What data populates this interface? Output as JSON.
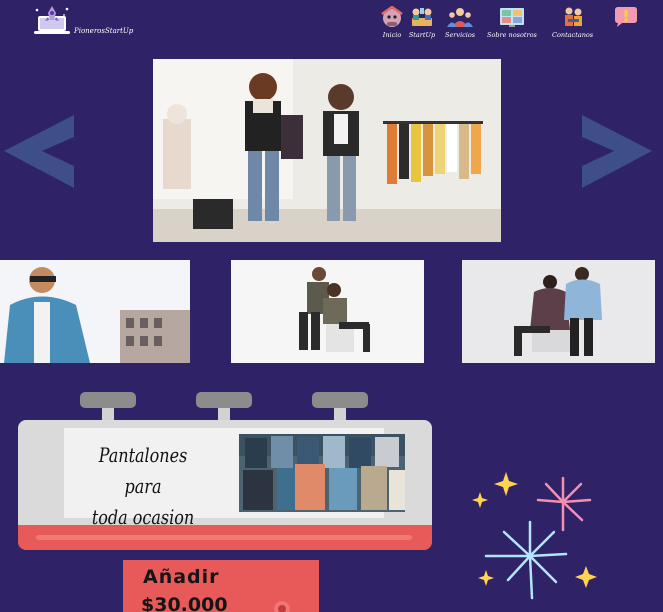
{
  "brand": {
    "name": "PionerosStartUp",
    "logo_icon": "rocket-laptop-icon"
  },
  "nav": {
    "items": [
      {
        "label": "Inicio",
        "icon": "home-character-icon"
      },
      {
        "label": "StartUp",
        "icon": "team-meeting-icon"
      },
      {
        "label": "Servicios",
        "icon": "support-people-icon"
      },
      {
        "label": "Sobre nosotros",
        "icon": "video-call-icon"
      },
      {
        "label": "Contactanos",
        "icon": "contact-people-icon"
      },
      {
        "label": "",
        "icon": "alert-chat-icon"
      }
    ]
  },
  "carousel": {
    "prev_icon": "chevron-left-icon",
    "next_icon": "chevron-right-icon",
    "slide": "clothing-store-photo"
  },
  "gallery": [
    {
      "image": "man-sunglasses-denim-photo"
    },
    {
      "image": "couple-casual-photo"
    },
    {
      "image": "women-fur-coats-photo"
    }
  ],
  "promo": {
    "title_line1": "Pantalones para",
    "title_line2": "toda ocasion",
    "image": "folded-jeans-photo",
    "add_label": "Añadir",
    "price": "$30.000",
    "cart_icon": "cart-badge-icon"
  },
  "decoration": {
    "icon": "fireworks-icon"
  },
  "colors": {
    "background": "#2f2266",
    "arrow": "#3d4f86",
    "counter_grey": "#dadada",
    "counter_red": "#e85a5a",
    "firework_pink": "#f48fb1",
    "firework_blue": "#b3e5fc",
    "sparkle_yellow": "#ffd54f"
  }
}
